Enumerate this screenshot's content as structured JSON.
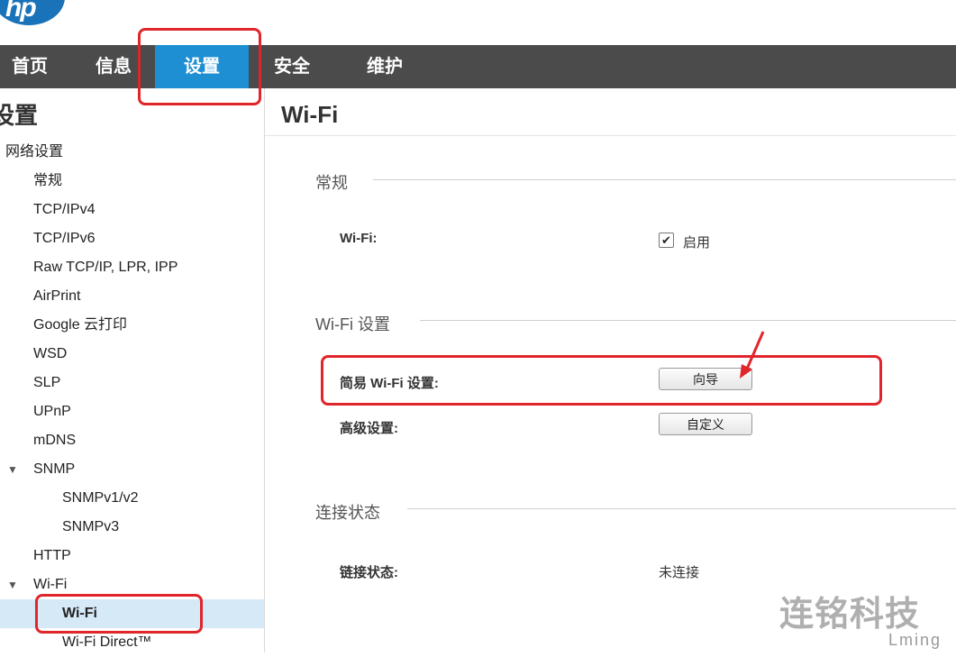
{
  "logo": {
    "text": "hp"
  },
  "topnav": {
    "tabs": [
      {
        "label": "首页"
      },
      {
        "label": "信息"
      },
      {
        "label": "设置",
        "active": true
      },
      {
        "label": "安全"
      },
      {
        "label": "维护"
      }
    ]
  },
  "sidebar": {
    "title": "设置",
    "items": [
      {
        "label": "网络设置"
      },
      {
        "label": "常规"
      },
      {
        "label": "TCP/IPv4"
      },
      {
        "label": "TCP/IPv6"
      },
      {
        "label": "Raw TCP/IP, LPR, IPP"
      },
      {
        "label": "AirPrint"
      },
      {
        "label": "Google 云打印"
      },
      {
        "label": "WSD"
      },
      {
        "label": "SLP"
      },
      {
        "label": "UPnP"
      },
      {
        "label": "mDNS"
      },
      {
        "label": "SNMP",
        "expanded": true
      },
      {
        "label": "SNMPv1/v2"
      },
      {
        "label": "SNMPv3"
      },
      {
        "label": "HTTP"
      },
      {
        "label": "Wi-Fi",
        "expanded": true
      },
      {
        "label": "Wi-Fi",
        "selected": true
      },
      {
        "label": "Wi-Fi Direct™"
      }
    ]
  },
  "main": {
    "title": "Wi-Fi",
    "general": {
      "heading": "常规",
      "wifi_label": "Wi-Fi:",
      "wifi_checkbox_label": "启用",
      "wifi_enabled": true
    },
    "wifi_settings": {
      "heading": "Wi-Fi 设置",
      "easy_label": "简易 Wi-Fi 设置:",
      "easy_button": "向导",
      "advanced_label": "高级设置:",
      "advanced_button": "自定义"
    },
    "connection": {
      "heading": "连接状态",
      "link_label": "链接状态:",
      "link_value": "未连接"
    }
  },
  "annotation": {
    "color": "#e0262b"
  },
  "watermark": {
    "cn": "连铭科技",
    "en": "Lming"
  },
  "colors": {
    "nav_bg": "#4b4b4b",
    "nav_active": "#1e8fd3",
    "selected_bg": "#d6e9f7",
    "hp_blue": "#1a72b8"
  }
}
